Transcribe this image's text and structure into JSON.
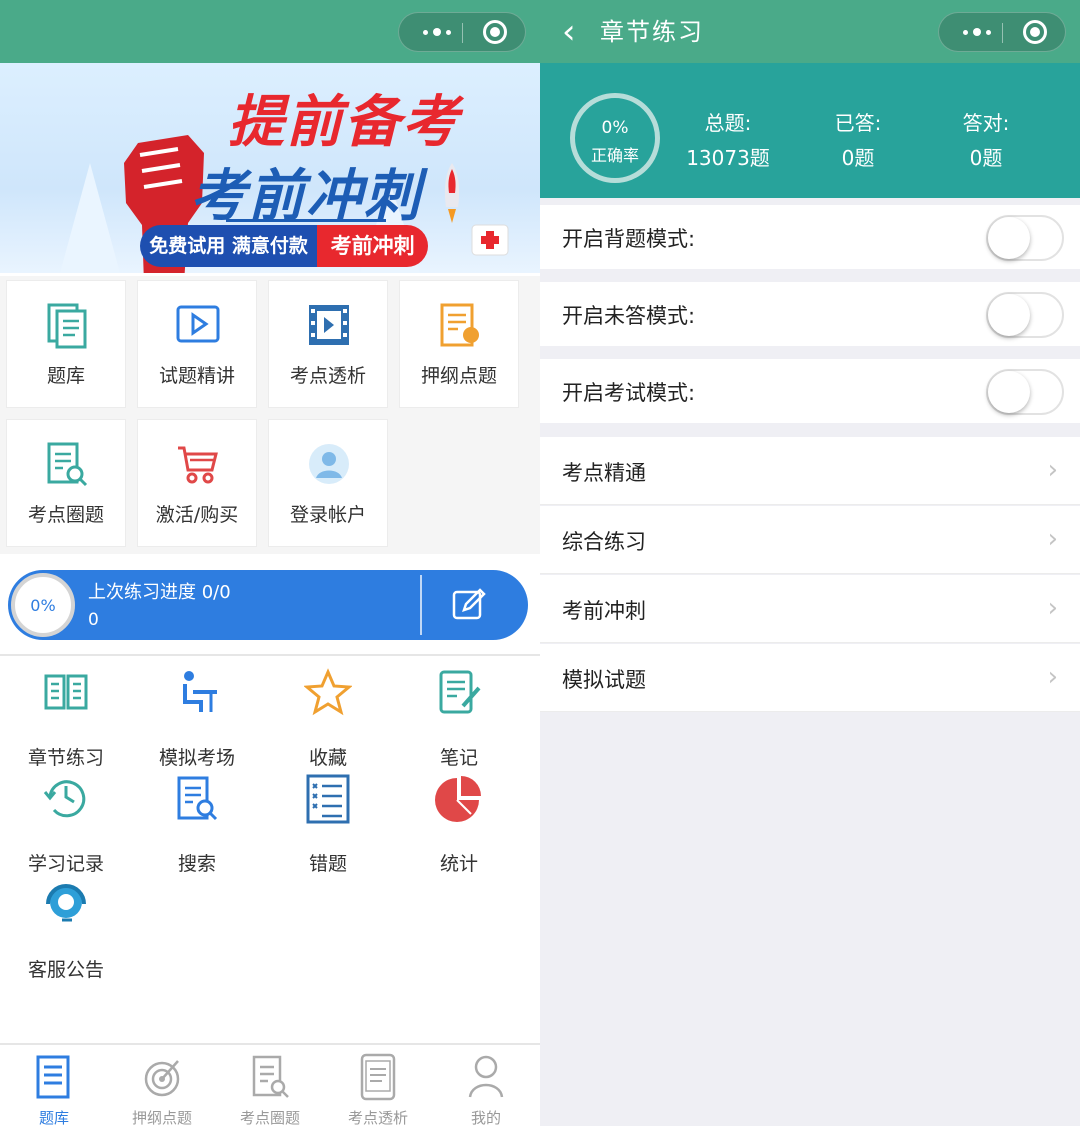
{
  "left": {
    "banner": {
      "headline1": "提前备考",
      "headline2": "考前冲刺",
      "pill_left": "免费试用 满意付款",
      "pill_right": "考前冲刺"
    },
    "cards": [
      {
        "label": "题库",
        "icon": "document-stack-icon"
      },
      {
        "label": "试题精讲",
        "icon": "video-play-icon"
      },
      {
        "label": "考点透析",
        "icon": "film-strip-icon"
      },
      {
        "label": "押纲点题",
        "icon": "certificate-icon"
      },
      {
        "label": "考点圈题",
        "icon": "doc-search-icon"
      },
      {
        "label": "激活/购买",
        "icon": "shopping-cart-icon"
      },
      {
        "label": "登录帐户",
        "icon": "user-avatar-icon"
      }
    ],
    "progress": {
      "percent": "0%",
      "title": "上次练习进度 0/0",
      "count": "0"
    },
    "menu": [
      {
        "label": "章节练习",
        "icon": "open-book-icon"
      },
      {
        "label": "模拟考场",
        "icon": "desk-student-icon"
      },
      {
        "label": "收藏",
        "icon": "star-icon"
      },
      {
        "label": "笔记",
        "icon": "notepad-pen-icon"
      },
      {
        "label": "学习记录",
        "icon": "history-clock-icon"
      },
      {
        "label": "搜索",
        "icon": "doc-search-icon"
      },
      {
        "label": "错题",
        "icon": "checklist-icon"
      },
      {
        "label": "统计",
        "icon": "pie-chart-icon"
      },
      {
        "label": "客服公告",
        "icon": "headset-icon"
      }
    ],
    "tabs": [
      {
        "label": "题库",
        "icon": "document-icon",
        "active": true
      },
      {
        "label": "押纲点题",
        "icon": "target-icon",
        "active": false
      },
      {
        "label": "考点圈题",
        "icon": "doc-search-icon",
        "active": false
      },
      {
        "label": "考点透析",
        "icon": "tablet-icon",
        "active": false
      },
      {
        "label": "我的",
        "icon": "user-icon",
        "active": false
      }
    ]
  },
  "right": {
    "nav_title": "章节练习",
    "accuracy": {
      "percent": "0%",
      "caption": "正确率"
    },
    "stats": [
      {
        "key": "总题:",
        "value": "13073题"
      },
      {
        "key": "已答:",
        "value": "0题"
      },
      {
        "key": "答对:",
        "value": "0题"
      }
    ],
    "toggles": [
      {
        "label": "开启背题模式:",
        "on": false
      },
      {
        "label": "开启未答模式:",
        "on": false
      },
      {
        "label": "开启考试模式:",
        "on": false
      }
    ],
    "list": [
      {
        "label": "考点精通"
      },
      {
        "label": "综合练习"
      },
      {
        "label": "考前冲刺"
      },
      {
        "label": "模拟试题"
      }
    ]
  },
  "colors": {
    "topbar": "#4aaa89",
    "stats_bg": "#28a39b",
    "primary_blue": "#2e7de0",
    "banner_red": "#e8282e",
    "banner_blue": "#1d5db5"
  }
}
